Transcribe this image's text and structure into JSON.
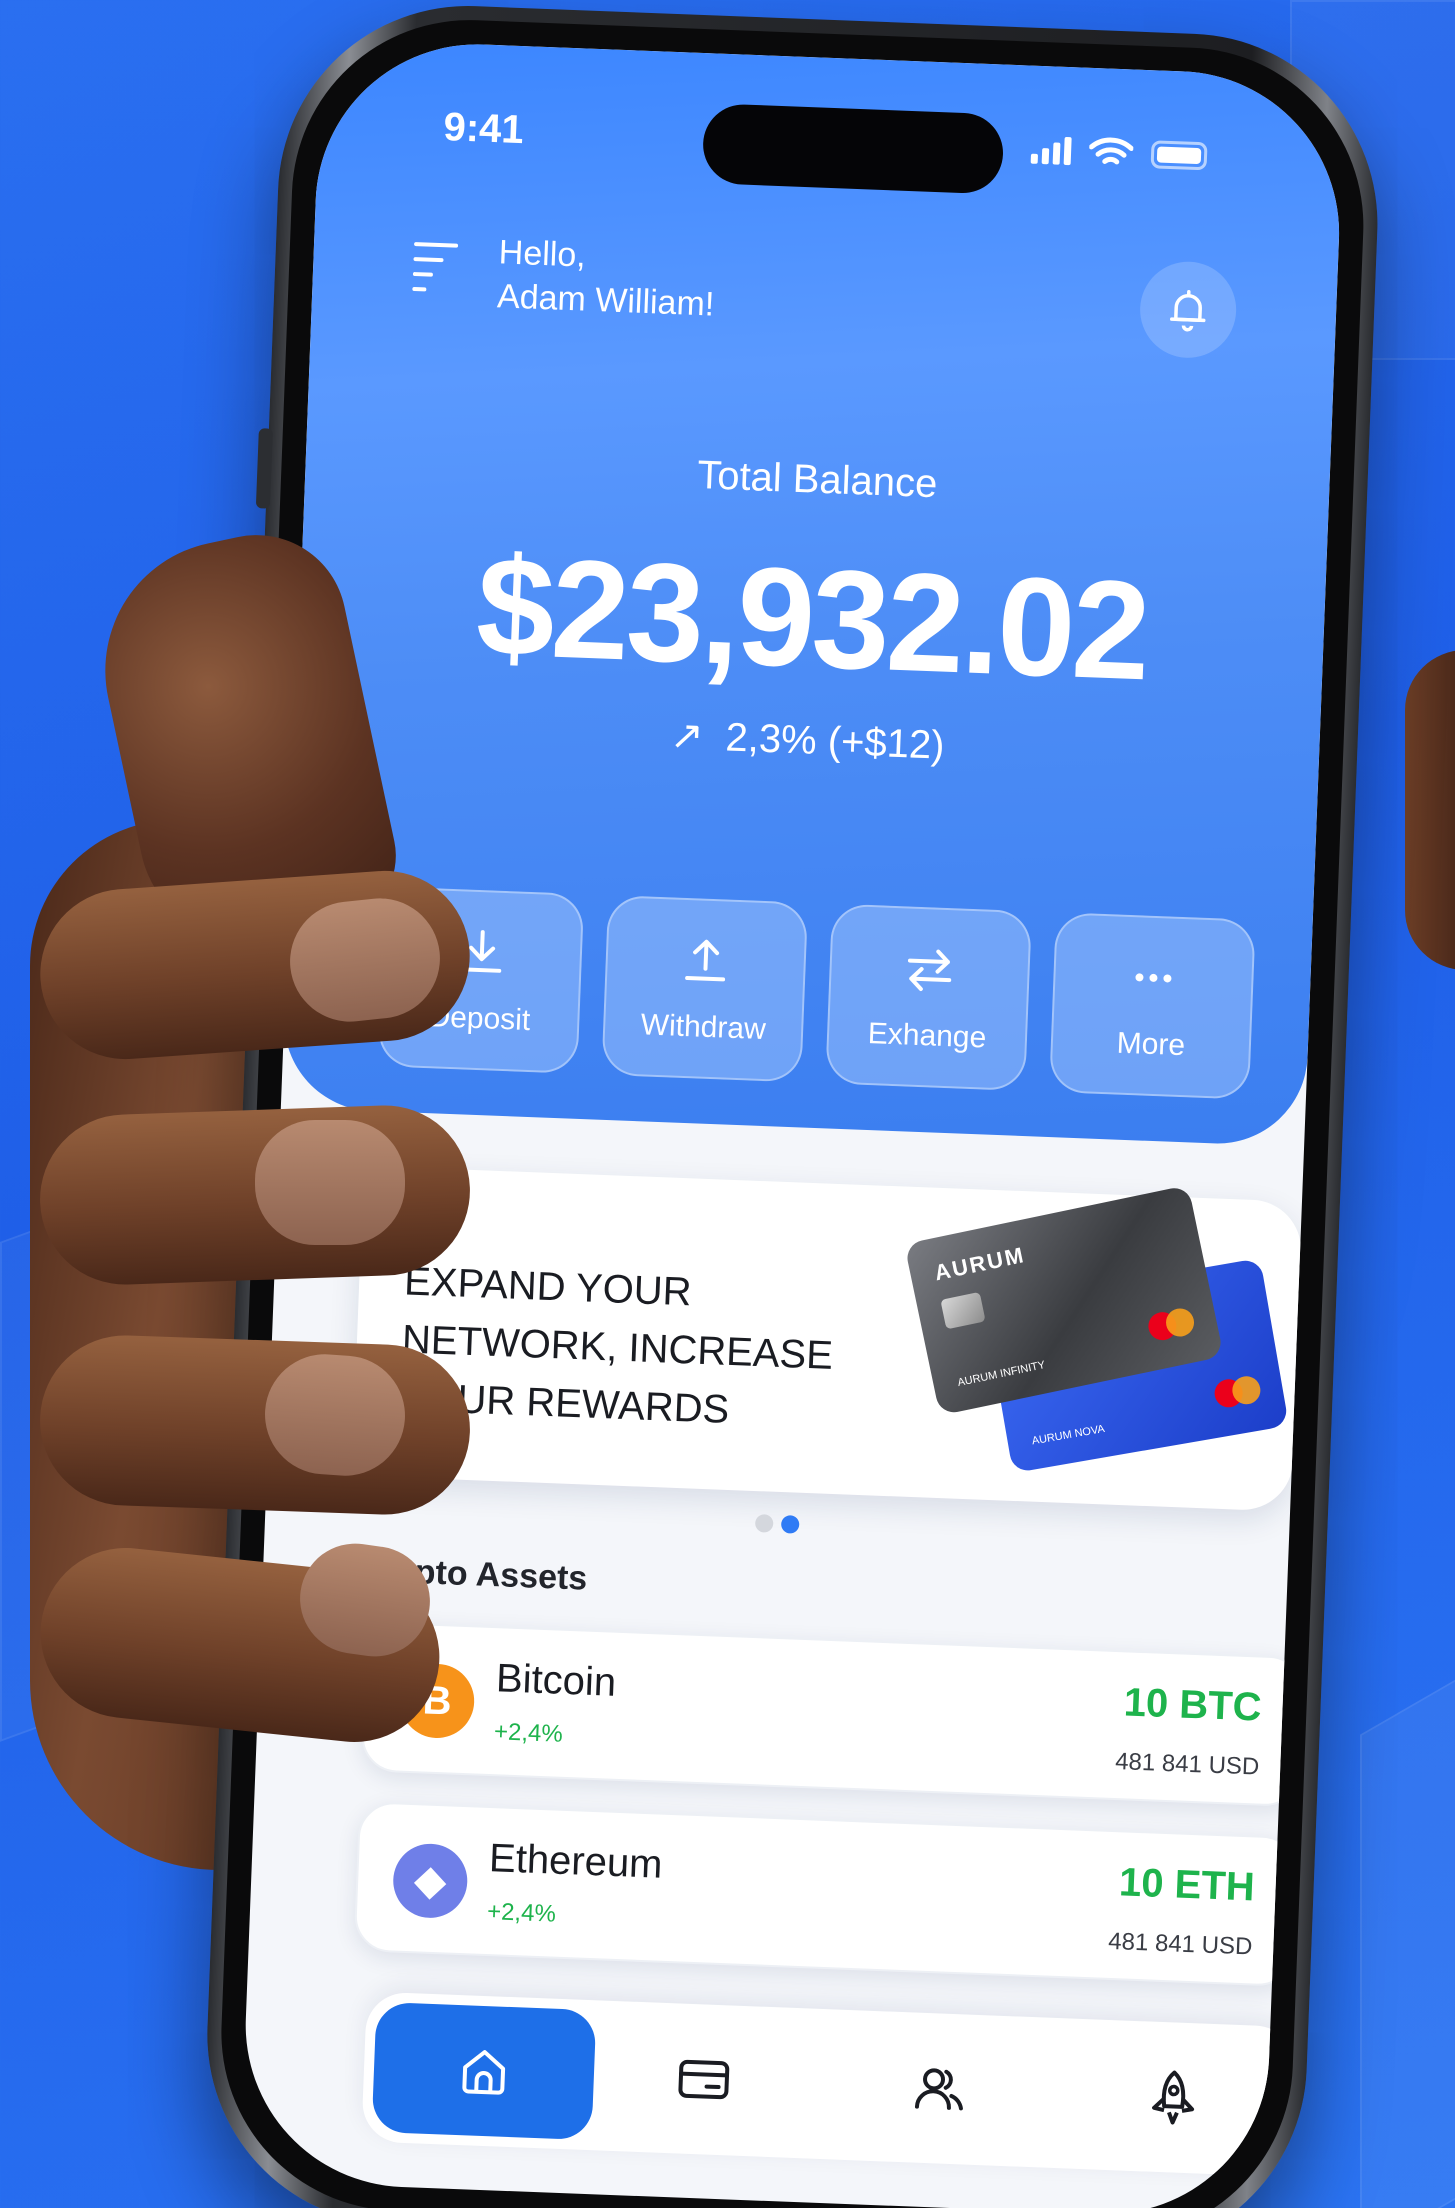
{
  "status_bar": {
    "time": "9:41"
  },
  "header": {
    "greeting_line1": "Hello,",
    "greeting_line2": "Adam William!"
  },
  "balance": {
    "label": "Total Balance",
    "amount": "$23,932.02",
    "change": "2,3% (+$12)"
  },
  "actions": [
    {
      "label": "Deposit",
      "icon": "download-icon"
    },
    {
      "label": "Withdraw",
      "icon": "upload-icon"
    },
    {
      "label": "Exhange",
      "icon": "swap-icon"
    },
    {
      "label": "More",
      "icon": "more-icon"
    }
  ],
  "promo": {
    "line1": "EXPAND YOUR",
    "line2": "NETWORK, INCREASE",
    "line3": "YOUR REWARDS",
    "card_front_brand": "AURUM",
    "card_front_name": "AURUM INFINITY",
    "card_back_name": "AURUM NOVA",
    "pager": {
      "count": 2,
      "active": 2
    }
  },
  "assets_title": "Crypto Assets",
  "assets": [
    {
      "name": "Bitcoin",
      "change": "+2,4%",
      "amount": "10 BTC",
      "usd": "481 841 USD",
      "symbol": "B"
    },
    {
      "name": "Ethereum",
      "change": "+2,4%",
      "amount": "10 ETH",
      "usd": "481 841 USD",
      "symbol": "◆"
    }
  ],
  "tabbar": [
    {
      "icon": "home-icon",
      "active": true
    },
    {
      "icon": "wallet-icon",
      "active": false
    },
    {
      "icon": "friends-icon",
      "active": false
    },
    {
      "icon": "rocket-icon",
      "active": false
    }
  ],
  "colors": {
    "background": "#2164ec",
    "hero": "#4d8df6",
    "positive": "#1eb34c",
    "active_tab": "#1e6fe8",
    "bitcoin": "#f7931a",
    "ethereum": "#6f7fe8"
  }
}
